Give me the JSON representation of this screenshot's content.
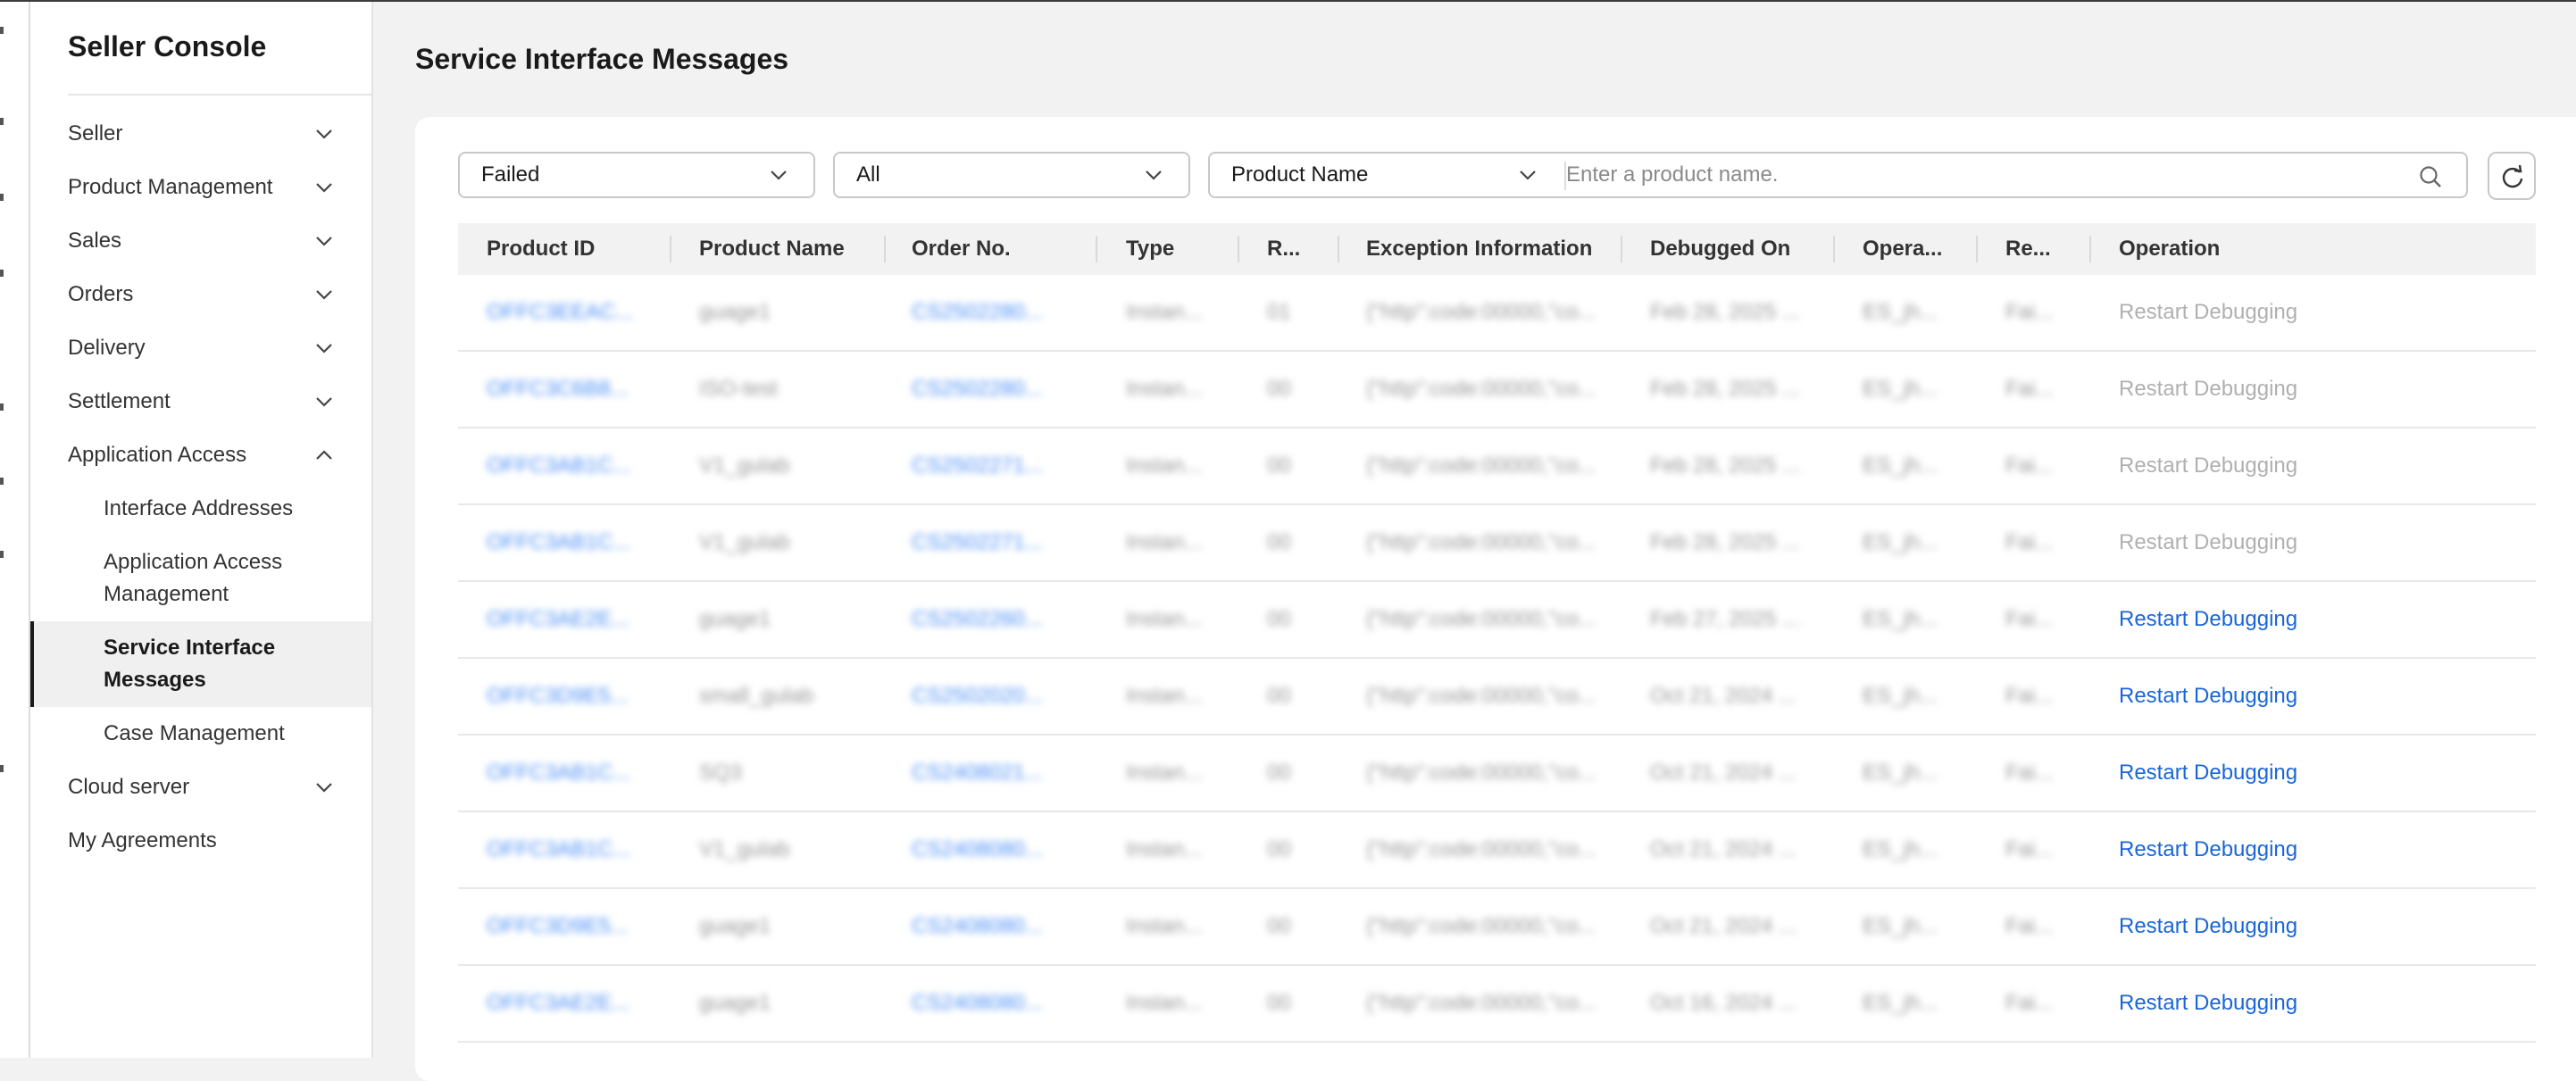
{
  "sidebar": {
    "title": "Seller Console",
    "items": [
      {
        "label": "Seller"
      },
      {
        "label": "Product Management"
      },
      {
        "label": "Sales"
      },
      {
        "label": "Orders"
      },
      {
        "label": "Delivery"
      },
      {
        "label": "Settlement"
      },
      {
        "label": "Application Access"
      },
      {
        "label": "Cloud server"
      },
      {
        "label": "My Agreements"
      }
    ],
    "subitems": [
      {
        "label": "Interface Addresses"
      },
      {
        "label": "Application Access Management"
      },
      {
        "label": "Service Interface Messages"
      },
      {
        "label": "Case Management"
      }
    ]
  },
  "page": {
    "title": "Service Interface Messages"
  },
  "filters": {
    "status": "Failed",
    "type": "All",
    "search_field": "Product Name",
    "search_placeholder": "Enter a product name."
  },
  "table": {
    "columns": [
      "Product ID",
      "Product Name",
      "Order No.",
      "Type",
      "R...",
      "Exception Information",
      "Debugged On",
      "Opera...",
      "Re...",
      "Operation"
    ],
    "rows": [
      {
        "product_id": "OFFC3EEAC...",
        "product_name": "guage1",
        "order_no": "CS2502280...",
        "type": "Instan...",
        "r": "01",
        "exception": "{\"http\":code:00000,\"co...",
        "debugged_on": "Feb 28, 2025 ...",
        "operator": "ES_jh...",
        "re": "Fai...",
        "operation": "Restart Debugging",
        "enabled": false
      },
      {
        "product_id": "OFFC3C6B8...",
        "product_name": "ISO-test",
        "order_no": "CS2502280...",
        "type": "Instan...",
        "r": "00",
        "exception": "{\"http\":code:00000,\"co...",
        "debugged_on": "Feb 28, 2025 ...",
        "operator": "ES_jh...",
        "re": "Fai...",
        "operation": "Restart Debugging",
        "enabled": false
      },
      {
        "product_id": "OFFC3AB1C...",
        "product_name": "V1_gulab",
        "order_no": "CS2502271...",
        "type": "Instan...",
        "r": "00",
        "exception": "{\"http\":code:00000,\"co...",
        "debugged_on": "Feb 28, 2025 ...",
        "operator": "ES_jh...",
        "re": "Fai...",
        "operation": "Restart Debugging",
        "enabled": false
      },
      {
        "product_id": "OFFC3AB1C...",
        "product_name": "V1_gulab",
        "order_no": "CS2502271...",
        "type": "Instan...",
        "r": "00",
        "exception": "{\"http\":code:00000,\"co...",
        "debugged_on": "Feb 28, 2025 ...",
        "operator": "ES_jh...",
        "re": "Fai...",
        "operation": "Restart Debugging",
        "enabled": false
      },
      {
        "product_id": "OFFC3AE2E...",
        "product_name": "guage1",
        "order_no": "CS2502260...",
        "type": "Instan...",
        "r": "00",
        "exception": "{\"http\":code:00000,\"co...",
        "debugged_on": "Feb 27, 2025 ...",
        "operator": "ES_jh...",
        "re": "Fai...",
        "operation": "Restart Debugging",
        "enabled": true
      },
      {
        "product_id": "OFFC3D9E5...",
        "product_name": "small_gulab",
        "order_no": "CS2502020...",
        "type": "Instan...",
        "r": "00",
        "exception": "{\"http\":code:00000,\"co...",
        "debugged_on": "Oct 21, 2024 ...",
        "operator": "ES_jh...",
        "re": "Fai...",
        "operation": "Restart Debugging",
        "enabled": true
      },
      {
        "product_id": "OFFC3AB1C...",
        "product_name": "SQ3",
        "order_no": "CS2408021...",
        "type": "Instan...",
        "r": "00",
        "exception": "{\"http\":code:00000,\"co...",
        "debugged_on": "Oct 21, 2024 ...",
        "operator": "ES_jh...",
        "re": "Fai...",
        "operation": "Restart Debugging",
        "enabled": true
      },
      {
        "product_id": "OFFC3AB1C...",
        "product_name": "V1_gulab",
        "order_no": "CS2408080...",
        "type": "Instan...",
        "r": "00",
        "exception": "{\"http\":code:00000,\"co...",
        "debugged_on": "Oct 21, 2024 ...",
        "operator": "ES_jh...",
        "re": "Fai...",
        "operation": "Restart Debugging",
        "enabled": true
      },
      {
        "product_id": "OFFC3D9E5...",
        "product_name": "guage1",
        "order_no": "CS2408080...",
        "type": "Instan...",
        "r": "00",
        "exception": "{\"http\":code:00000,\"co...",
        "debugged_on": "Oct 21, 2024 ...",
        "operator": "ES_jh...",
        "re": "Fai...",
        "operation": "Restart Debugging",
        "enabled": true
      },
      {
        "product_id": "OFFC3AE2E...",
        "product_name": "guage1",
        "order_no": "CS2408080...",
        "type": "Instan...",
        "r": "00",
        "exception": "{\"http\":code:00000,\"co...",
        "debugged_on": "Oct 16, 2024 ...",
        "operator": "ES_jh...",
        "re": "Fai...",
        "operation": "Restart Debugging",
        "enabled": true
      }
    ]
  },
  "colors": {
    "link": "#1a66d8",
    "disabled": "#b0b0b0",
    "header_bg": "#f2f2f2"
  }
}
